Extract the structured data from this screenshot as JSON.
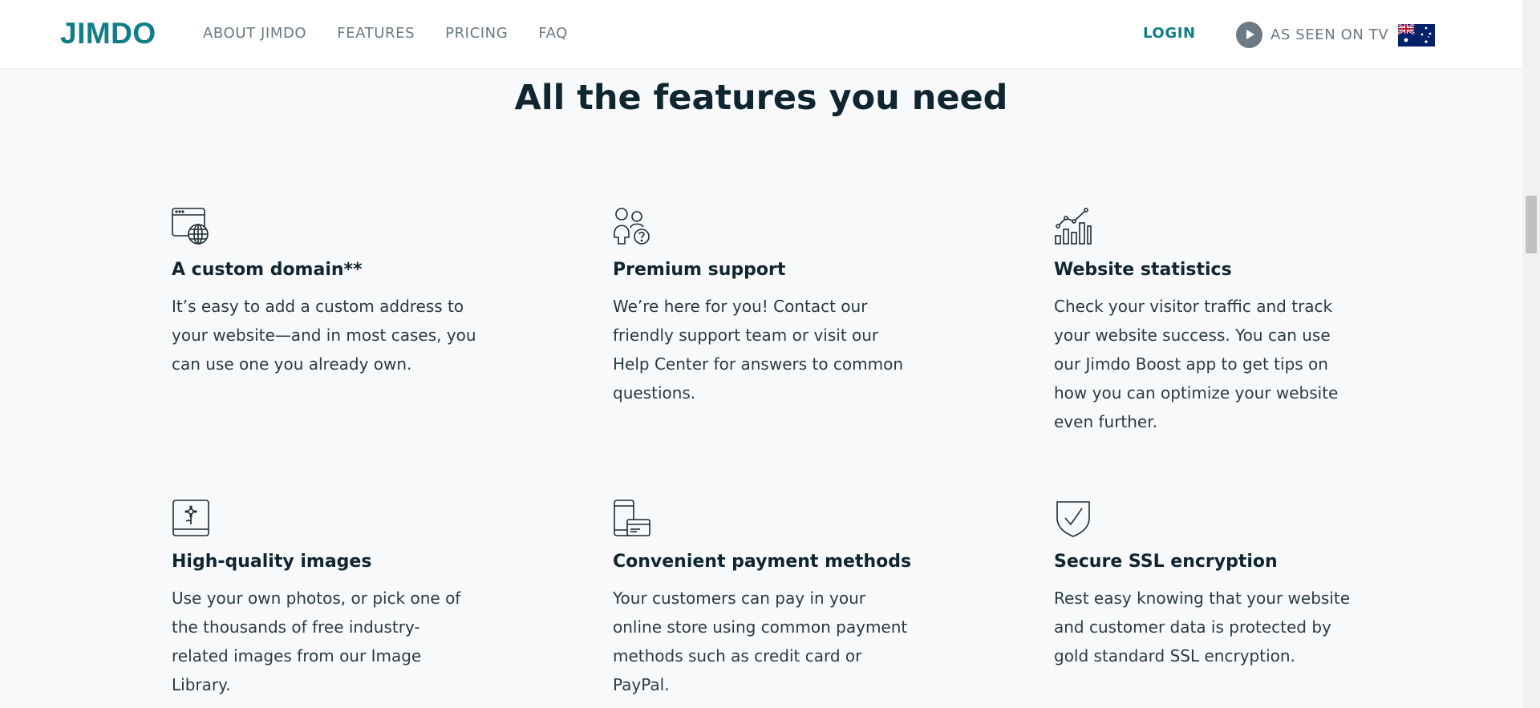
{
  "header": {
    "logo": "JIMDO",
    "nav": [
      {
        "label": "ABOUT JIMDO"
      },
      {
        "label": "FEATURES"
      },
      {
        "label": "PRICING"
      },
      {
        "label": "FAQ"
      }
    ],
    "login_label": "LOGIN",
    "tv_label": "AS SEEN ON TV",
    "flag": "australia-flag"
  },
  "section_title": "All the features you need",
  "features": [
    {
      "icon": "domain-globe-icon",
      "title": "A custom domain**",
      "text": "It’s easy to add a custom address to your website—and in most cases, you can use one you already own."
    },
    {
      "icon": "support-people-icon",
      "title": "Premium support",
      "text": "We’re here for you! Contact our friendly support team or visit our Help Center for answers to common questions."
    },
    {
      "icon": "statistics-chart-icon",
      "title": "Website statistics",
      "text": "Check your visitor traffic and track your website success. You can use our Jimdo Boost app to get tips on how you can optimize your website even further."
    },
    {
      "icon": "image-flower-icon",
      "title": "High-quality images",
      "text": "Use your own photos, or pick one of the thousands of free industry-related images from our Image Library."
    },
    {
      "icon": "payment-card-icon",
      "title": "Convenient payment methods",
      "text": "Your customers can pay in your online store using common payment methods such as credit card or PayPal."
    },
    {
      "icon": "shield-check-icon",
      "title": "Secure SSL encryption",
      "text": "Rest easy knowing that your website and customer data is protected by gold standard SSL encryption."
    }
  ],
  "colors": {
    "accent": "#0f7e86",
    "nav_text": "#6b7982",
    "heading": "#102530",
    "background": "#f8f9fa"
  }
}
